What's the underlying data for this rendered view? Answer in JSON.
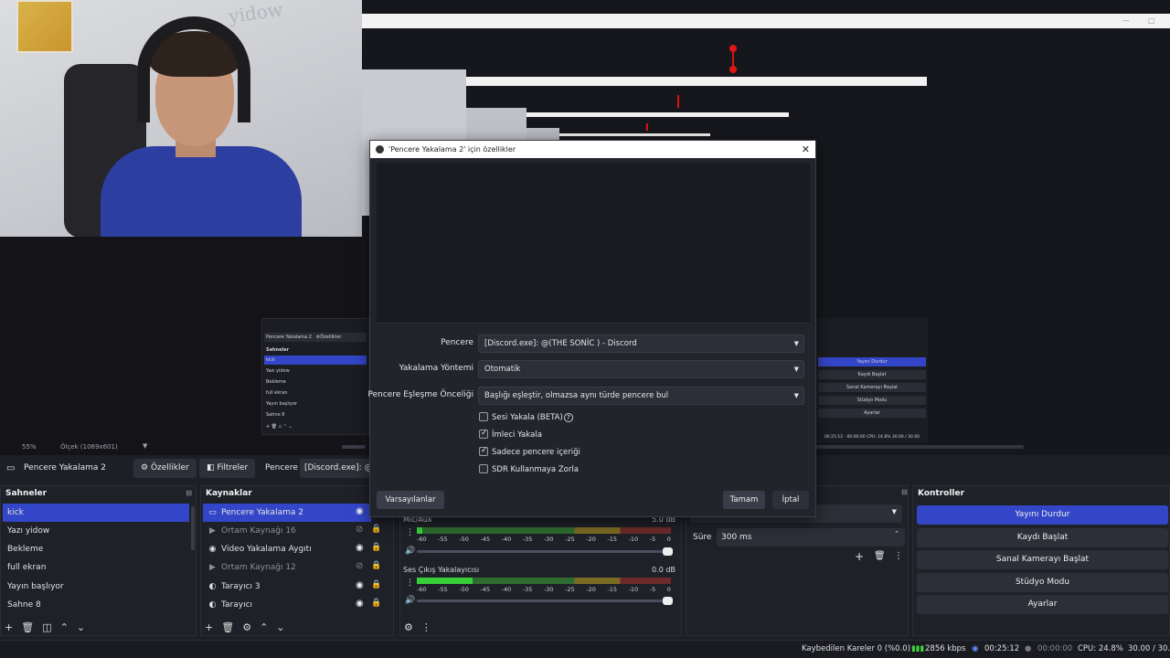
{
  "preview": {
    "wall_text": "yidow",
    "zoom_label": "55%",
    "scale_label": "Ölçek (1069x601)",
    "mini": {
      "tb_label": "Pencere Yakalama 2",
      "tb_props": "Özellikler",
      "scenes_header": "Sahneler",
      "scenes": [
        "kick",
        "Yazı yidow",
        "Bekleme",
        "full ekran",
        "Yayın başlıyor",
        "Sahne 8"
      ],
      "controls": [
        "Yayını Durdur",
        "Kaydı Başlat",
        "Sanal Kamerayı Başlat",
        "Stüdyo Modu",
        "Ayarlar"
      ],
      "status": "00:25:12   ·   00:00:00   CPU: 24.8%   30.00 / 30.00"
    }
  },
  "dialog": {
    "title": "'Pencere Yakalama 2' için özellikler",
    "fields": [
      {
        "label": "Pencere",
        "value": "[Discord.exe]: @(THE SONİC ) - Discord"
      },
      {
        "label": "Yakalama Yöntemi",
        "value": "Otomatik"
      },
      {
        "label": "Pencere Eşleşme Önceliği",
        "value": "Başlığı eşleştir, olmazsa aynı türde pencere bul"
      }
    ],
    "checkboxes": [
      {
        "label": "Sesi Yakala (BETA)",
        "checked": false
      },
      {
        "label": "İmleci Yakala",
        "checked": true
      },
      {
        "label": "Sadece pencere içeriği",
        "checked": true
      },
      {
        "label": "SDR Kullanmaya Zorla",
        "checked": false
      }
    ],
    "defaults_label": "Varsayılanlar",
    "ok_label": "Tamam",
    "cancel_label": "İptal"
  },
  "source_toolbar": {
    "source_name": "Pencere Yakalama 2",
    "properties_label": "Özellikler",
    "filters_label": "Filtreler",
    "window_label": "Pencere",
    "window_value": "[Discord.exe]: @(T"
  },
  "scenes": {
    "header": "Sahneler",
    "items": [
      "kick",
      "Yazı yidow",
      "Bekleme",
      "full ekran",
      "Yayın başlıyor",
      "Sahne 8"
    ],
    "selected": 0
  },
  "sources": {
    "header": "Kaynaklar",
    "items": [
      {
        "label": "Pencere Yakalama 2",
        "icon": "window-icon",
        "visible": true,
        "selected": true
      },
      {
        "label": "Ortam Kaynağı 16",
        "icon": "play-icon",
        "visible": false,
        "selected": false
      },
      {
        "label": "Video Yakalama Aygıtı",
        "icon": "camera-icon",
        "visible": true,
        "selected": false
      },
      {
        "label": "Ortam Kaynağı 12",
        "icon": "play-icon",
        "visible": false,
        "selected": false
      },
      {
        "label": "Tarayıcı 3",
        "icon": "globe-icon",
        "visible": true,
        "selected": false
      },
      {
        "label": "Tarayıcı",
        "icon": "globe-icon",
        "visible": true,
        "selected": false
      }
    ]
  },
  "mixer": {
    "channels": [
      {
        "name": "Mic/Aux",
        "db": "5.0 dB",
        "level": 0.02
      },
      {
        "name": "Ses Çıkış Yakalayıcısı",
        "db": "0.0 dB",
        "level": 0.22
      }
    ],
    "scale": [
      "-60",
      "-55",
      "-50",
      "-45",
      "-40",
      "-35",
      "-30",
      "-25",
      "-20",
      "-15",
      "-10",
      "-5",
      "0"
    ]
  },
  "transitions": {
    "duration_label": "Süre",
    "duration_value": "300 ms"
  },
  "controls": {
    "header": "Kontroller",
    "buttons": [
      "Yayını Durdur",
      "Kaydı Başlat",
      "Sanal Kamerayı Başlat",
      "Stüdyo Modu",
      "Ayarlar"
    ]
  },
  "status": {
    "dropped": "Kaybedilen Kareler 0 (%0.0)",
    "bitrate": "2856 kbps",
    "stream_time": "00:25:12",
    "record_time": "00:00:00",
    "cpu": "CPU: 24.8%",
    "fps": "30.00 / 30.00"
  }
}
